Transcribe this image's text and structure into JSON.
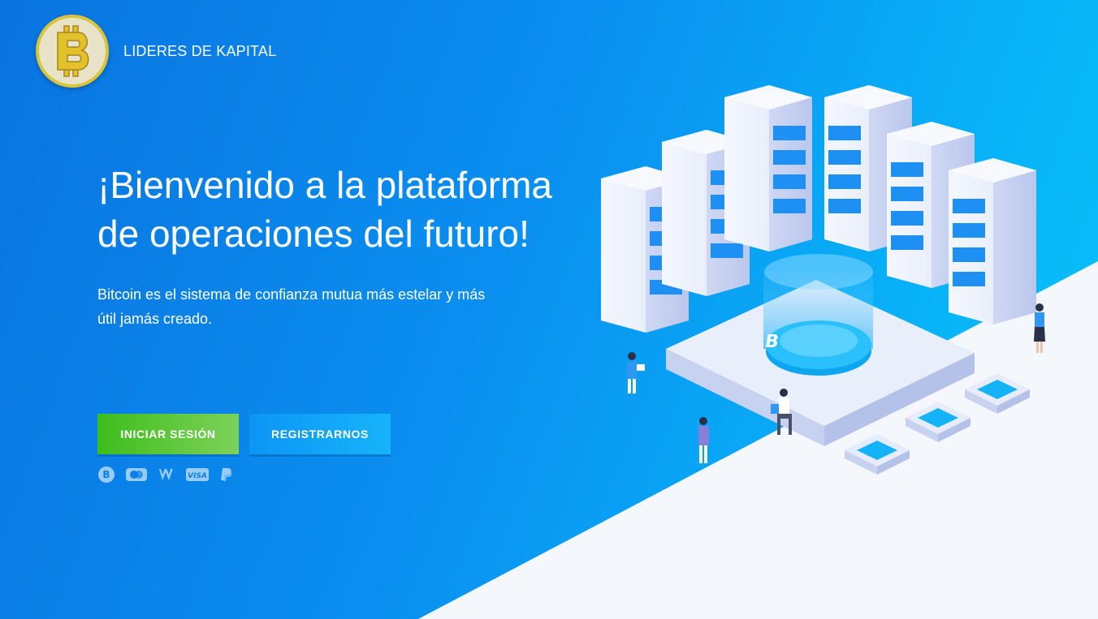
{
  "header": {
    "brand_name": "LIDERES DE KAPITAL",
    "logo_icon": "bitcoin-coin-icon"
  },
  "hero": {
    "title": "¡Bienvenido a la plataforma de operaciones del futuro!",
    "subtitle": "Bitcoin es el sistema de confianza mutua más estelar y más útil jamás creado."
  },
  "buttons": {
    "login_label": "INICIAR SESIÓN",
    "register_label": "REGISTRARNOS"
  },
  "payment_methods": {
    "visa_label": "VISA",
    "icons": [
      "bitcoin-icon",
      "card-icon",
      "webmoney-icon",
      "visa-icon",
      "paypal-icon"
    ]
  },
  "colors": {
    "login_button": "#3ebd1c",
    "register_button": "#0c95f6",
    "background_start": "#0a74e0",
    "background_end": "#0bc4fb",
    "logo_ring": "#d8c53a"
  }
}
